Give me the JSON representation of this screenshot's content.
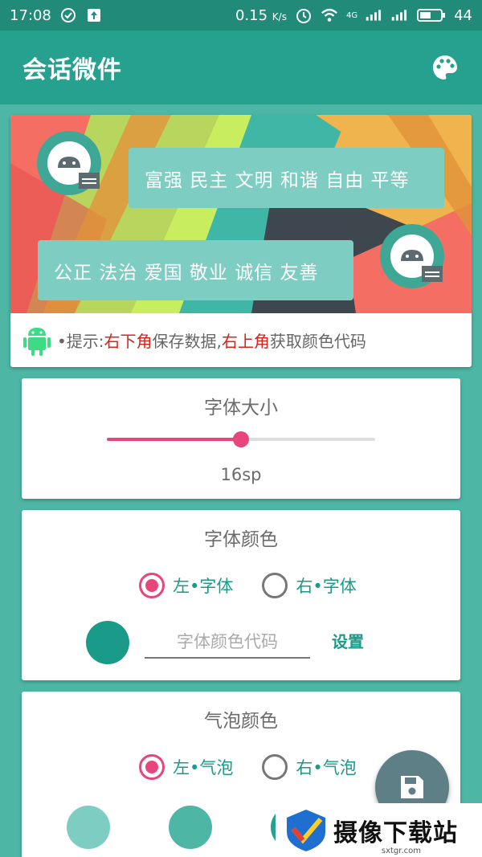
{
  "status_bar": {
    "time": "17:08",
    "speed": "0.15",
    "speed_unit": "K/s",
    "network": "4G",
    "battery": "44"
  },
  "app_bar": {
    "title": "会话微件",
    "palette_icon": "palette-icon"
  },
  "preview": {
    "bubble_right_text": "富强 民主 文明 和谐 自由 平等",
    "bubble_left_text": "公正 法治 爱国 敬业 诚信 友善",
    "hint_prefix": "•提示:",
    "hint_red1": "右下角",
    "hint_mid": "保存数据,",
    "hint_red2": "右上角",
    "hint_suffix": "获取颜色代码"
  },
  "font_size": {
    "title": "字体大小",
    "value": "16sp",
    "slider_fraction": 0.5
  },
  "font_color": {
    "title": "字体颜色",
    "radio_left": "左•字体",
    "radio_right": "右•字体",
    "selected": "left",
    "swatch_color": "#1a9a89",
    "input_placeholder": "字体颜色代码",
    "set_label": "设置"
  },
  "bubble_color": {
    "title": "气泡颜色",
    "radio_left": "左•气泡",
    "radio_right": "右•气泡",
    "selected": "left",
    "swatch_colors": [
      "#7ecdc3",
      "#4db6a5",
      "#26a18f"
    ]
  },
  "colors": {
    "primary_dark": "#218a79",
    "primary": "#26a18f",
    "background": "#4db6a5",
    "accent": "#e8457d",
    "bubble": "#7ecdc3"
  },
  "watermark": {
    "text": "摄像下载站",
    "sub": "sxtgr.com"
  }
}
